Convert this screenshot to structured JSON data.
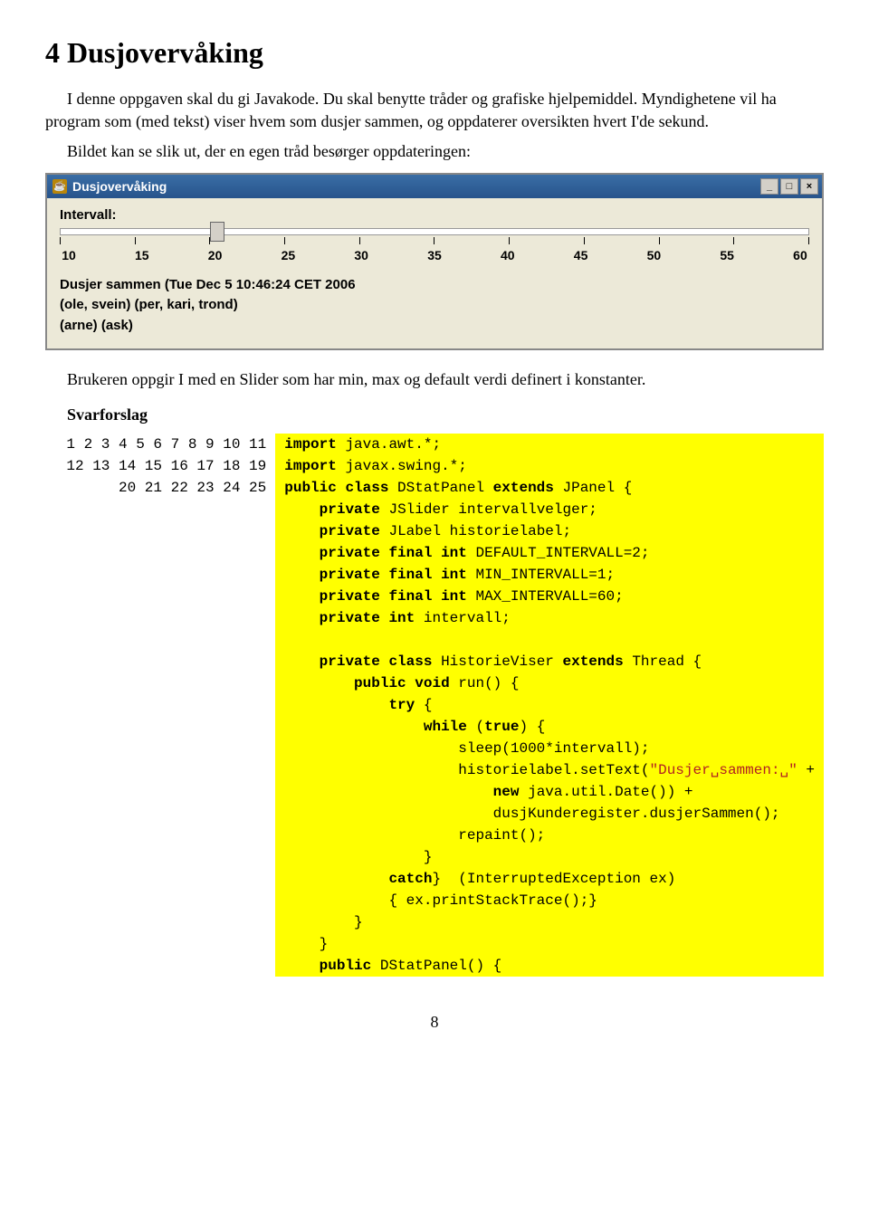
{
  "heading": "4  Dusjovervåking",
  "para1": "I denne oppgaven skal du gi Javakode. Du skal benytte tråder og grafiske hjelpemiddel. Myndighetene vil ha program som (med tekst) viser hvem som dusjer sammen, og oppdaterer oversikten hvert I'de sekund.",
  "para2": "Bildet kan se slik ut, der en egen tråd besørger oppdateringen:",
  "win": {
    "title": "Dusjovervåking",
    "intervall": "Intervall:",
    "ticks": [
      "10",
      "15",
      "20",
      "25",
      "30",
      "35",
      "40",
      "45",
      "50",
      "55",
      "60"
    ],
    "status1": "Dusjer sammen (Tue Dec  5 10:46:24 CET 2006",
    "status2": "(ole, svein) (per, kari, trond)",
    "status3": "(arne) (ask)"
  },
  "para3": "Brukeren oppgir I med en Slider som har min, max og default verdi definert i konstanter.",
  "svar": "Svarforslag",
  "code": [
    {
      "n": "1",
      "t": "import",
      "r": " java.awt.*;"
    },
    {
      "n": "2",
      "t": "import",
      "r": " javax.swing.*;"
    },
    {
      "n": "3",
      "t": "public class",
      "mid": " DStatPanel ",
      "t2": "extends",
      "r": " JPanel {"
    },
    {
      "n": "4",
      "pad": "    ",
      "t": "private",
      "r": " JSlider intervallvelger;"
    },
    {
      "n": "5",
      "pad": "    ",
      "t": "private",
      "r": " JLabel historielabel;"
    },
    {
      "n": "6",
      "pad": "    ",
      "t": "private final int",
      "r": " DEFAULT_INTERVALL=2;"
    },
    {
      "n": "7",
      "pad": "    ",
      "t": "private final int",
      "r": " MIN_INTERVALL=1;"
    },
    {
      "n": "8",
      "pad": "    ",
      "t": "private final int",
      "r": " MAX_INTERVALL=60;"
    },
    {
      "n": "9",
      "pad": "    ",
      "t": "private int",
      "r": " intervall;"
    },
    {
      "n": "10",
      "pad": "",
      "t": "",
      "r": ""
    },
    {
      "n": "11",
      "pad": "    ",
      "t": "private class",
      "mid": " HistorieViser ",
      "t2": "extends",
      "r": " Thread {"
    },
    {
      "n": "12",
      "pad": "        ",
      "t": "public void",
      "r": " run() {"
    },
    {
      "n": "13",
      "pad": "            ",
      "t": "try",
      "r": " {"
    },
    {
      "n": "14",
      "pad": "                ",
      "t": "while",
      "mid": " (",
      "t2": "true",
      "r": ") {"
    },
    {
      "n": "15",
      "pad": "                    ",
      "t": "",
      "r": "sleep(1000*intervall);"
    },
    {
      "n": "16",
      "pad": "                    ",
      "t": "",
      "r": "historielabel.setText(",
      "str": "\"Dusjer␣sammen:␣\"",
      "r2": " +"
    },
    {
      "n": "17",
      "pad": "                        ",
      "t": "new",
      "r": " java.util.Date()) +"
    },
    {
      "n": "18",
      "pad": "                        ",
      "t": "",
      "r": "dusjKunderegister.dusjerSammen();"
    },
    {
      "n": "19",
      "pad": "                    ",
      "t": "",
      "r": "repaint();"
    },
    {
      "n": "20",
      "pad": "                ",
      "t": "",
      "r": "}"
    },
    {
      "n": "21",
      "pad": "            ",
      "t": "",
      "r": "} ",
      "t2": "catch",
      "r2": " (InterruptedException ex)"
    },
    {
      "n": "22",
      "pad": "            ",
      "t": "",
      "r": "{ ex.printStackTrace();}"
    },
    {
      "n": "23",
      "pad": "        ",
      "t": "",
      "r": "}"
    },
    {
      "n": "24",
      "pad": "    ",
      "t": "",
      "r": "}"
    },
    {
      "n": "25",
      "pad": "    ",
      "t": "public",
      "r": " DStatPanel() {"
    }
  ],
  "pagenum": "8"
}
